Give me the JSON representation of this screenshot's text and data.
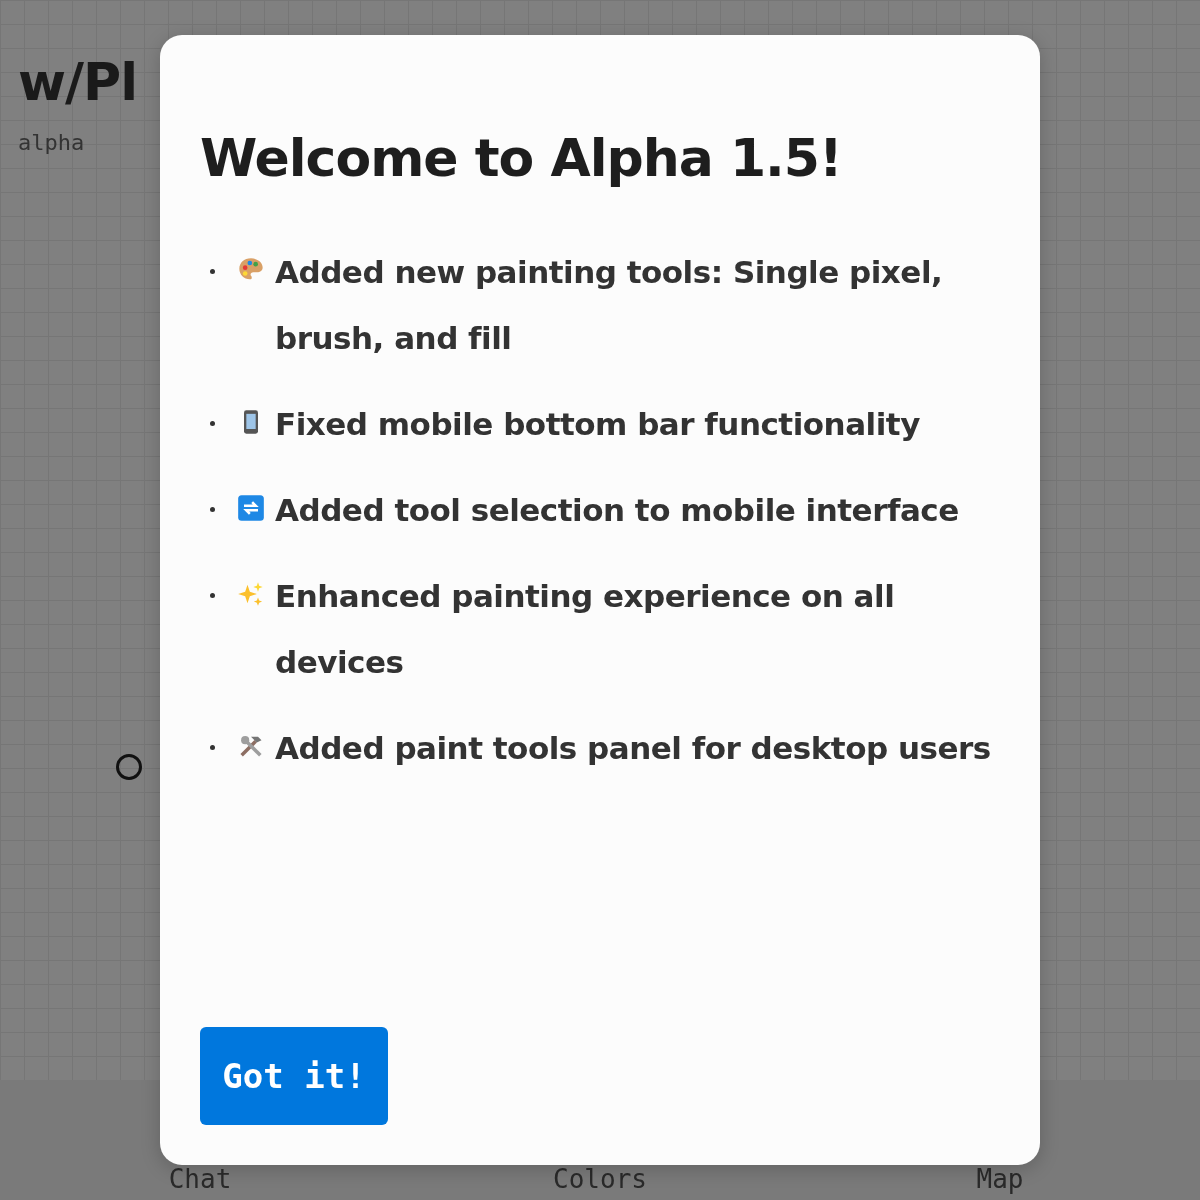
{
  "app": {
    "logo": "w/Pl",
    "version_label": "alpha"
  },
  "bottom_nav": [
    {
      "label": "Chat"
    },
    {
      "label": "Colors"
    },
    {
      "label": "Map"
    }
  ],
  "dialog": {
    "title": "Welcome to Alpha 1.5!",
    "items": [
      {
        "kind": "palette",
        "text": "Added new painting tools: Single pixel, brush, and fill"
      },
      {
        "kind": "phone",
        "text": "Fixed mobile bottom bar functionality"
      },
      {
        "kind": "arrows",
        "text": "Added tool selection to mobile interface"
      },
      {
        "kind": "sparkles",
        "text": "Enhanced painting experience on all devices"
      },
      {
        "kind": "tools",
        "text": "Added paint tools panel for desktop users"
      }
    ],
    "button": "Got it!"
  }
}
